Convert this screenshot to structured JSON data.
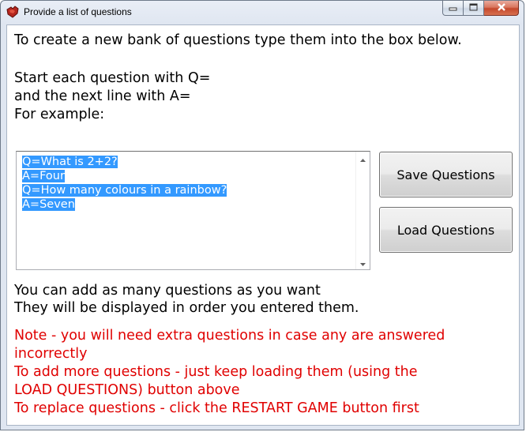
{
  "window": {
    "title": "Provide a list of questions"
  },
  "caption_buttons": {
    "minimize": "minimize-icon",
    "maximize": "maximize-icon",
    "close": "close-icon"
  },
  "instructions": {
    "line1": "To create a new bank of questions type them into the box below.",
    "line2": "Start each question with Q=",
    "line3": "and the next line with A=",
    "line4": "For example:"
  },
  "questions_box": {
    "lines": [
      "Q=What is 2+2?",
      "A=Four",
      "Q=How many colours in a rainbow?",
      "A=Seven"
    ],
    "selection_color": "#3399ff"
  },
  "buttons": {
    "save_label": "Save Questions",
    "load_label": "Load Questions"
  },
  "info": {
    "line1": "You can add as many questions as you want",
    "line2": "They will be displayed in order you entered them."
  },
  "notes": {
    "color": "#e00000",
    "line1": "Note - you will need extra questions in case any are answered",
    "line2": "incorrectly",
    "line3": "To add more questions - just keep loading them (using the",
    "line4": "LOAD QUESTIONS) button above",
    "line5": "To replace questions - click the RESTART GAME button first"
  }
}
